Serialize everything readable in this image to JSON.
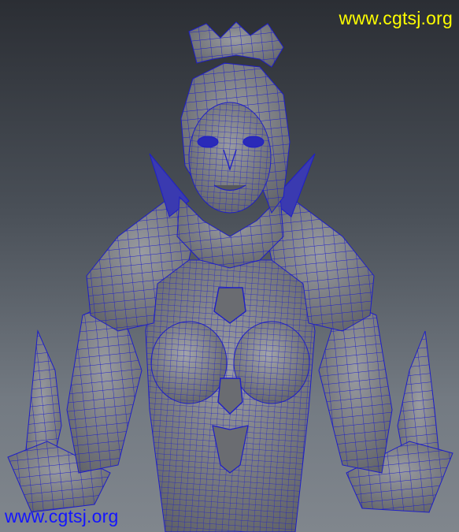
{
  "watermark_top": {
    "text": "www.cgtsj.org",
    "color": "#ffff00"
  },
  "watermark_bottom": {
    "text": "www.cgtsj.org",
    "color": "#1414ff"
  },
  "colors": {
    "wire": "#1e1ec8",
    "surface": "#7b7d83",
    "surface_dark": "#5f6166",
    "surface_light": "#9a9ca1"
  }
}
